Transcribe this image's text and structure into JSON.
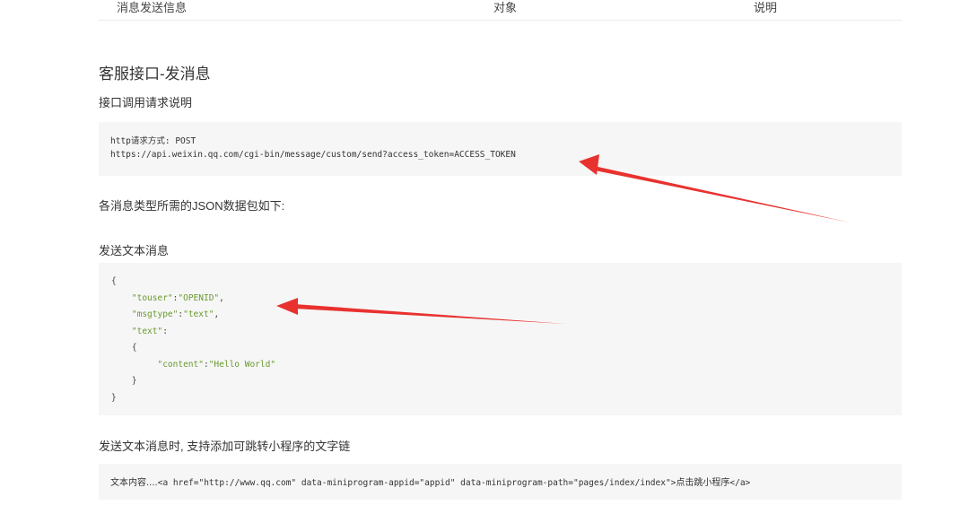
{
  "top_row": {
    "col1": "消息发送信息",
    "col2": "对象",
    "col3": "说明"
  },
  "section_title": "客服接口-发消息",
  "api_call_heading": "接口调用请求说明",
  "http_request": {
    "method_label": "http请求方式: POST",
    "url": "https://api.weixin.qq.com/cgi-bin/message/custom/send?access_token=ACCESS_TOKEN"
  },
  "json_intro": "各消息类型所需的JSON数据包如下:",
  "send_text_heading": "发送文本消息",
  "text_message_code": {
    "line1": "{",
    "line2_key": "\"touser\"",
    "line2_val": "\"OPENID\"",
    "line3_key": "\"msgtype\"",
    "line3_val": "\"text\"",
    "line4_key": "\"text\"",
    "line5": "{",
    "line6_key": "\"content\"",
    "line6_val": "\"Hello World\"",
    "line7": "}",
    "line8": "}"
  },
  "miniprogram_heading": "发送文本消息时, 支持添加可跳转小程序的文字链",
  "miniprogram_code": {
    "prefix": "文本内容....",
    "tag": "<a href=\"http://www.qq.com\" data-miniprogram-appid=\"appid\" data-miniprogram-path=\"pages/index/index\">",
    "link_text": "点击跳小程序",
    "close_tag": "</a>"
  },
  "colors": {
    "code_bg": "#f6f6f6",
    "string_green": "#6a9a2f",
    "annotation_red": "#e8322f"
  }
}
